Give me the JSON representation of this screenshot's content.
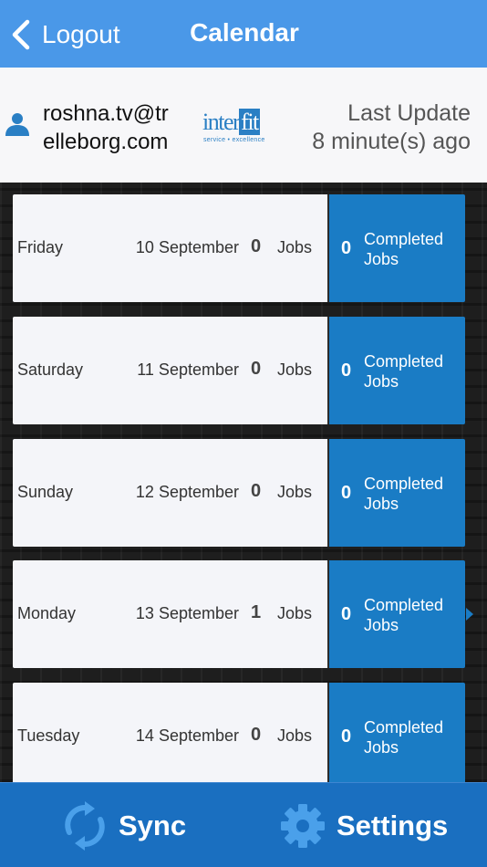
{
  "navbar": {
    "back_label": "Logout",
    "title": "Calendar"
  },
  "header": {
    "email_line1": "roshna.tv@tr",
    "email_line2": "elleborg.com",
    "logo": {
      "text_part1": "inter",
      "text_part2": "fit",
      "tagline": "service • excellence"
    },
    "last_update_label": "Last Update",
    "last_update_value": "8 minute(s) ago"
  },
  "days": [
    {
      "day": "Friday",
      "date": "10 September",
      "jobs": "0",
      "jobs_label": "Jobs",
      "completed": "0",
      "completed_label": "Completed Jobs",
      "selected": false
    },
    {
      "day": "Saturday",
      "date": "11 September",
      "jobs": "0",
      "jobs_label": "Jobs",
      "completed": "0",
      "completed_label": "Completed Jobs",
      "selected": false
    },
    {
      "day": "Sunday",
      "date": "12 September",
      "jobs": "0",
      "jobs_label": "Jobs",
      "completed": "0",
      "completed_label": "Completed Jobs",
      "selected": false
    },
    {
      "day": "Monday",
      "date": "13 September",
      "jobs": "1",
      "jobs_label": "Jobs",
      "completed": "0",
      "completed_label": "Completed Jobs",
      "selected": true
    },
    {
      "day": "Tuesday",
      "date": "14 September",
      "jobs": "0",
      "jobs_label": "Jobs",
      "completed": "0",
      "completed_label": "Completed Jobs",
      "selected": false
    }
  ],
  "toolbar": {
    "sync_label": "Sync",
    "settings_label": "Settings"
  },
  "colors": {
    "navbar": "#4a98e8",
    "completed_panel": "#1a7cc5",
    "toolbar": "#1a6fc0",
    "icon_blue": "#4aa0ea"
  },
  "icons": {
    "back": "chevron-left-icon",
    "user": "user-icon",
    "sync": "sync-icon",
    "settings": "gear-icon"
  }
}
